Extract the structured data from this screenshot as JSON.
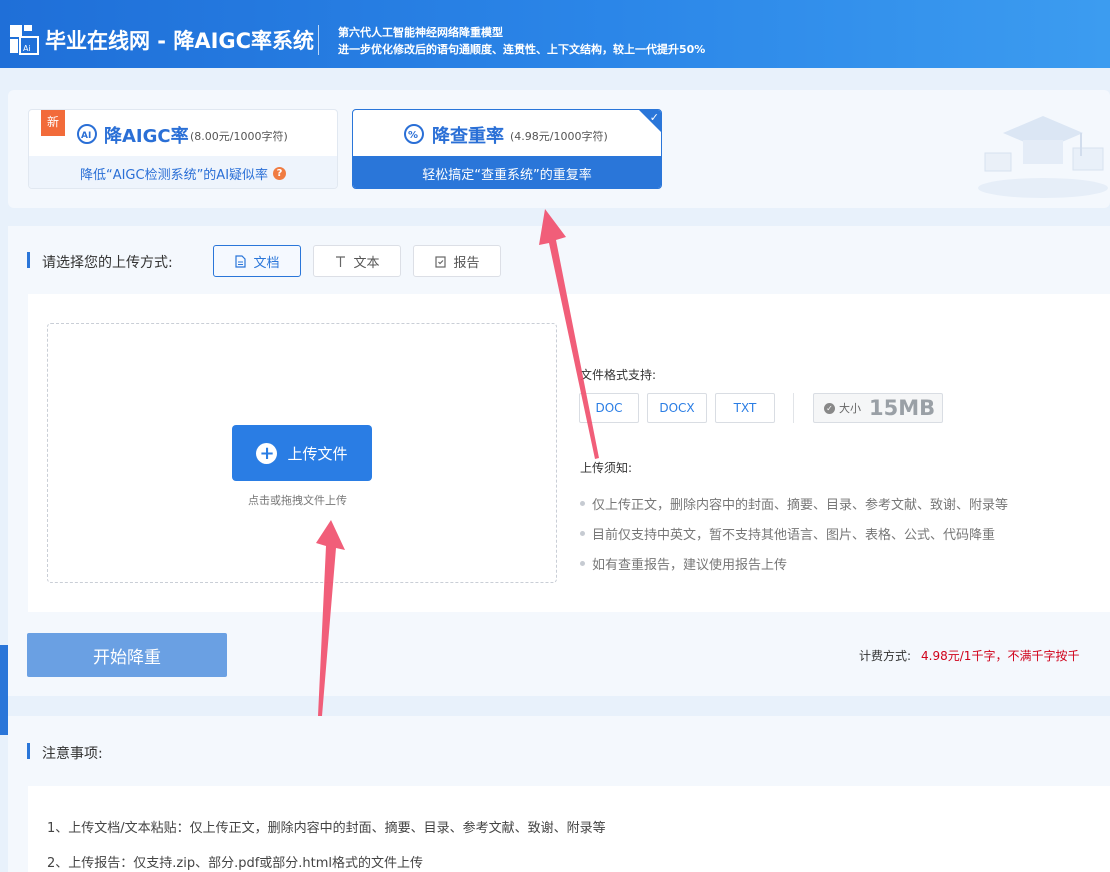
{
  "header": {
    "brand": "毕业在线网 - 降AIGC率系统",
    "slogan_line1": "第六代人工智能神经网络降重模型",
    "slogan_line2": "进一步优化修改后的语句通顺度、连贯性、上下文结构，较上一代提升50%"
  },
  "modes": {
    "aigc": {
      "badge": "新",
      "title": "降AIGC率",
      "price": "(8.00元/1000字符)",
      "desc": "降低“AIGC检测系统”的AI疑似率",
      "help": "?"
    },
    "dup": {
      "title": "降查重率",
      "price": "(4.98元/1000字符)",
      "desc": "轻松搞定“查重系统”的重复率",
      "selected": true
    }
  },
  "upload": {
    "label": "请选择您的上传方式:",
    "tabs": [
      {
        "label": "文档",
        "icon": "document-icon",
        "active": true
      },
      {
        "label": "文本",
        "icon": "text-icon",
        "active": false
      },
      {
        "label": "报告",
        "icon": "report-icon",
        "active": false
      }
    ],
    "button": "上传文件",
    "hint": "点击或拖拽文件上传",
    "format_label": "文件格式支持:",
    "formats": [
      "DOC",
      "DOCX",
      "TXT"
    ],
    "size_label": "大小",
    "size_value": "15MB",
    "notice_title": "上传须知:",
    "notices": [
      "仅上传正文，删除内容中的封面、摘要、目录、参考文献、致谢、附录等",
      "目前仅支持中英文，暂不支持其他语言、图片、表格、公式、代码降重",
      "如有查重报告，建议使用报告上传"
    ]
  },
  "action": {
    "start": "开始降重",
    "billing_label": "计费方式:",
    "billing_price": "4.98元/1千字，不满千字按千"
  },
  "notes": {
    "title": "注意事项:",
    "items": [
      "1、上传文档/文本粘贴：仅上传正文，删除内容中的封面、摘要、目录、参考文献、致谢、附录等",
      "2、上传报告：仅支持.zip、部分.pdf或部分.html格式的文件上传"
    ]
  },
  "colors": {
    "primary": "#2a76d9",
    "accent_red": "#d0021b",
    "annotation_arrow": "#f0506e"
  }
}
